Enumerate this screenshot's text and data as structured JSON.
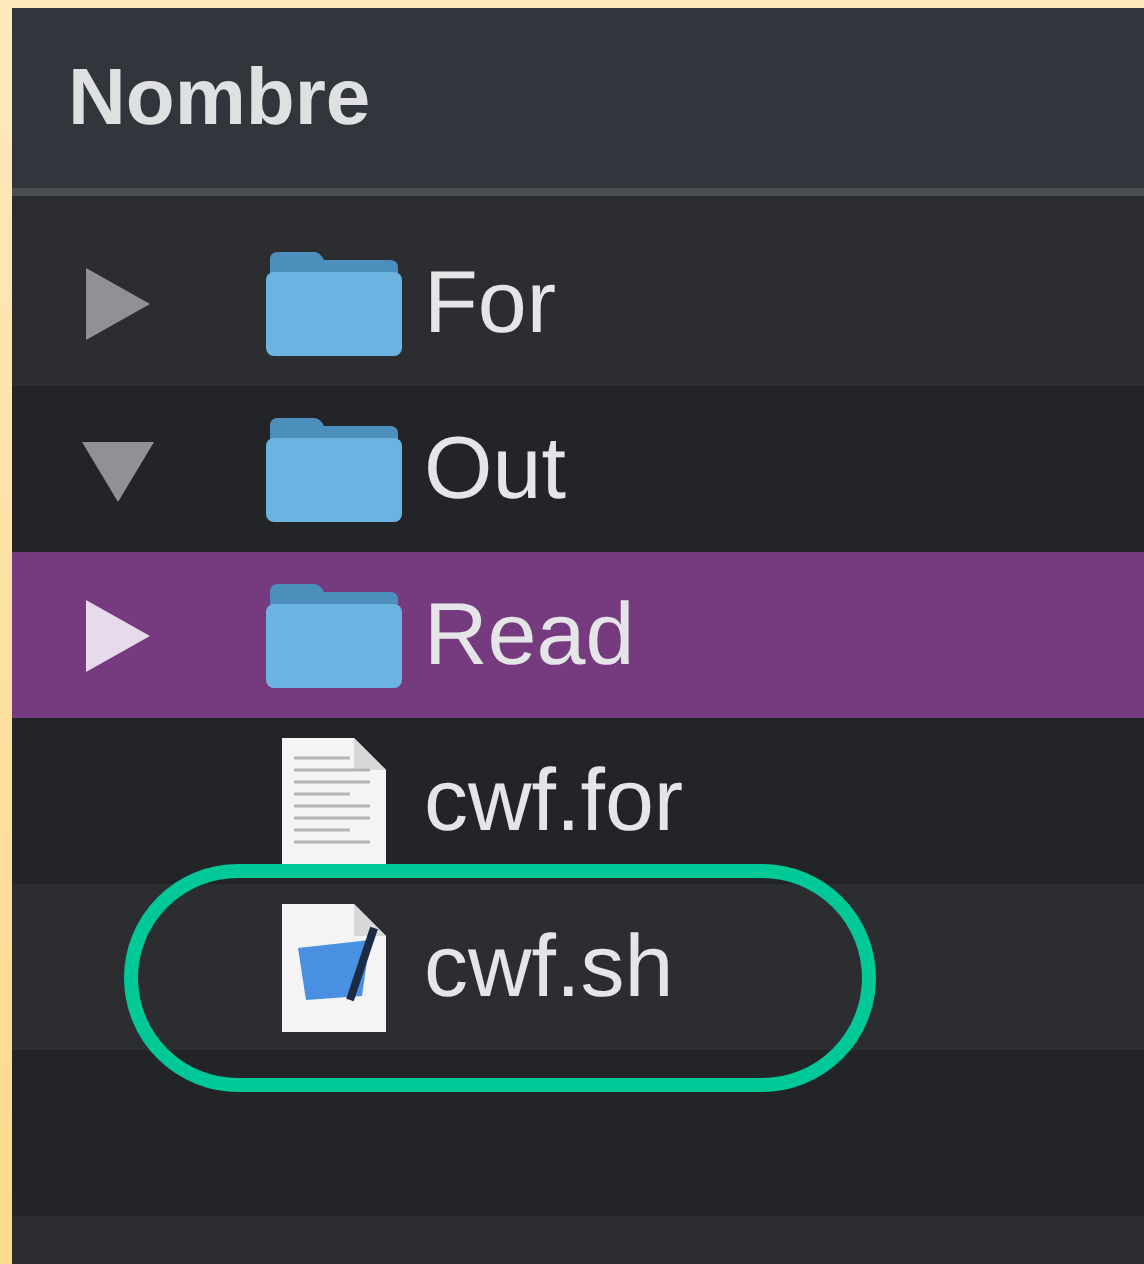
{
  "header": {
    "column": "Nombre"
  },
  "items": [
    {
      "kind": "folder",
      "name": "For",
      "expanded": false,
      "selected": false,
      "circled": false
    },
    {
      "kind": "folder",
      "name": "Out",
      "expanded": true,
      "selected": false,
      "circled": false
    },
    {
      "kind": "folder",
      "name": "Read",
      "expanded": false,
      "selected": true,
      "circled": false
    },
    {
      "kind": "text-file",
      "name": "cwf.for",
      "selected": false,
      "circled": false
    },
    {
      "kind": "script-file",
      "name": "cwf.sh",
      "selected": false,
      "circled": true
    }
  ]
}
